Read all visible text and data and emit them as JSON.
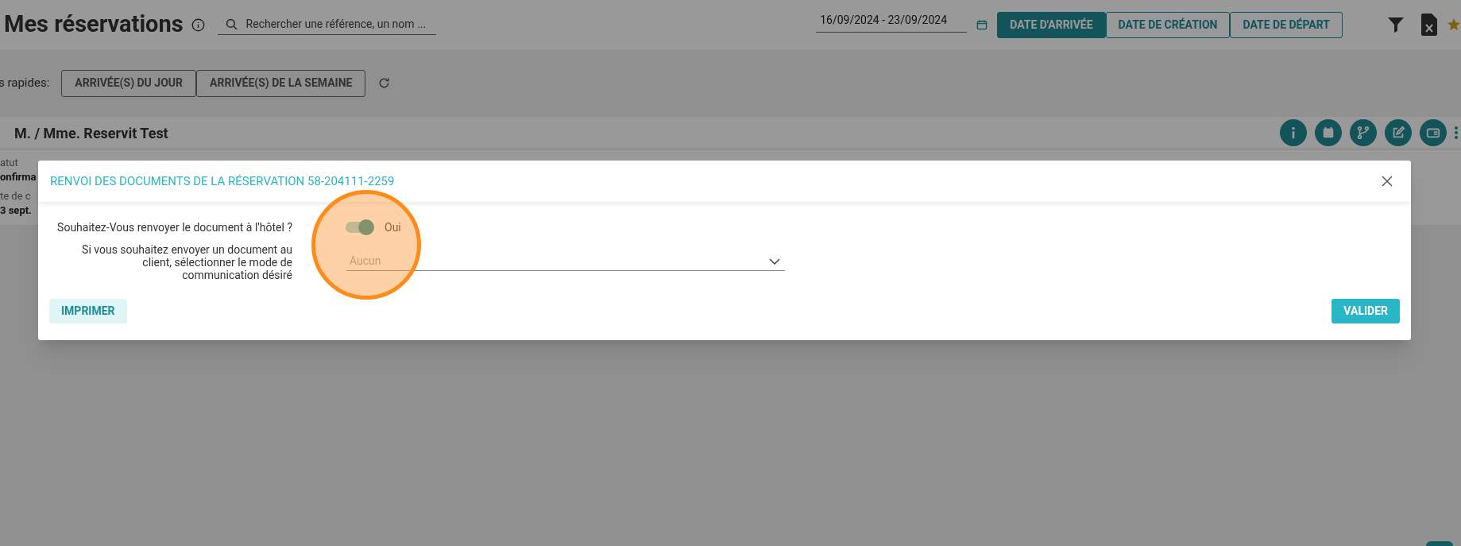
{
  "header": {
    "title": "Mes réservations",
    "search": {
      "placeholder": "Rechercher une référence, un nom ..."
    },
    "date_range": "16/09/2024 - 23/09/2024",
    "date_tabs": [
      {
        "label": "DATE D'ARRIVÉE",
        "selected": true
      },
      {
        "label": "DATE DE CRÉATION",
        "selected": false
      },
      {
        "label": "DATE DE DÉPART",
        "selected": false
      }
    ]
  },
  "quick_filters": {
    "label": "s rapides:",
    "buttons": [
      "ARRIVÉE(S) DU JOUR",
      "ARRIVÉE(S) DE LA SEMAINE"
    ]
  },
  "booking_card": {
    "guest": "M. / Mme. Reservit Test",
    "fields": [
      {
        "label": "atut",
        "value": "onfirma"
      },
      {
        "label": "te de c",
        "value": "3 sept."
      }
    ]
  },
  "dialog": {
    "title": "RENVOI DES DOCUMENTS DE LA RÉSERVATION 58-204111-2259",
    "resend_hotel": {
      "label": "Souhaitez-Vous renvoyer le document à l'hôtel ?",
      "on": true,
      "state_label": "Oui"
    },
    "communication": {
      "label": "Si vous souhaitez envoyer un document au client, sélectionner le mode de communication désiré",
      "placeholder": "Aucun"
    },
    "buttons": [
      {
        "kind": "secondary",
        "label": "IMPRIMER"
      },
      {
        "kind": "primary",
        "label": "VALIDER"
      }
    ]
  }
}
